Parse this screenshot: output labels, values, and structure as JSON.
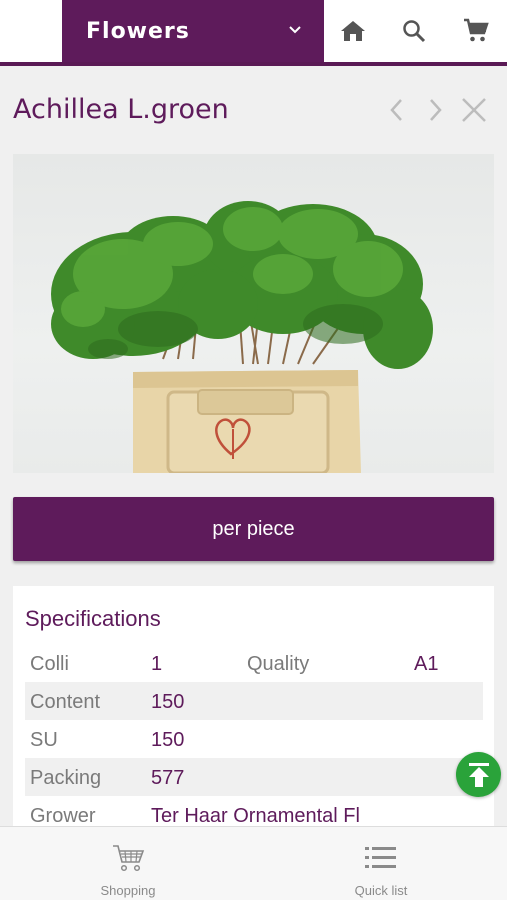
{
  "header": {
    "category_label": "Flowers",
    "icons": [
      "chevron-down-icon",
      "home-icon",
      "search-icon",
      "cart-icon"
    ]
  },
  "product": {
    "title": "Achillea L.groen",
    "nav_icons": [
      "chevron-left-icon",
      "chevron-right-icon",
      "close-icon"
    ],
    "crate_logo": "heart-logo"
  },
  "action": {
    "unit_button_label": "per piece"
  },
  "specifications": {
    "title": "Specifications",
    "rows": [
      {
        "label": "Colli",
        "value": "1",
        "label2": "Quality",
        "value2": "A1"
      },
      {
        "label": "Content",
        "value": "150"
      },
      {
        "label": "SU",
        "value": "150"
      },
      {
        "label": "Packing",
        "value": "577"
      },
      {
        "label": "Grower",
        "value": "Ter Haar Ornamental Fl"
      }
    ]
  },
  "bottom_nav": {
    "items": [
      {
        "label": "Shopping",
        "icon": "shopping-cart-icon"
      },
      {
        "label": "Quick list",
        "icon": "list-icon"
      }
    ]
  },
  "colors": {
    "brand": "#5e1b5b",
    "scroll_top": "#2aa33a"
  }
}
